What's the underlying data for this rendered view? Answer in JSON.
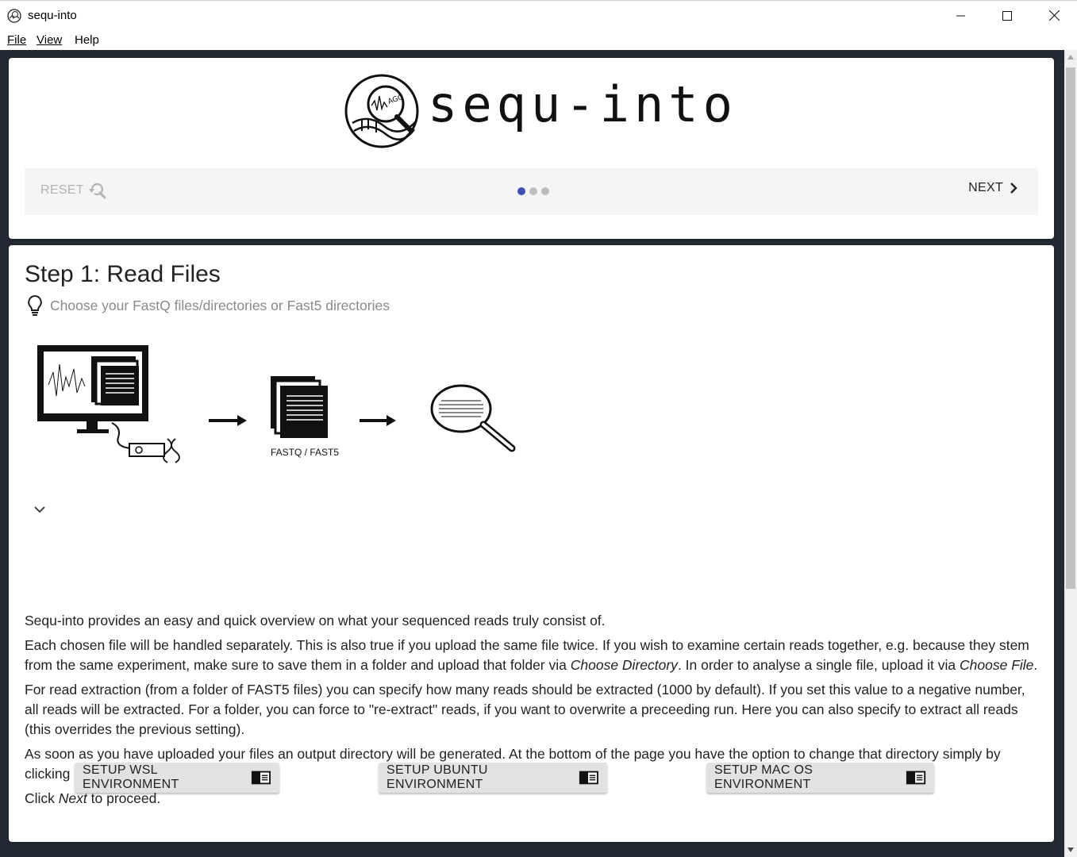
{
  "window": {
    "title": "sequ-into"
  },
  "menu": {
    "file": "File",
    "view": "View",
    "help": "Help"
  },
  "header": {
    "logo_text": "sequ-into",
    "reset_label": "RESET",
    "next_label": "NEXT",
    "steps_total": 3,
    "step_active": 1
  },
  "step": {
    "title": "Step 1: Read Files",
    "hint": "Choose your FastQ files/directories or Fast5 directories",
    "diagram_label": "FASTQ / FAST5"
  },
  "paragraphs": {
    "p1": "Sequ-into provides an easy and quick overview on what your sequenced reads truly consist of.",
    "p2a": "Each chosen file will be handled separately. This is also true if you upload the same file twice. If you wish to examine certain reads together, e.g. because they stem from the same experiment, make sure to save them in a folder and upload that folder via ",
    "p2b": "Choose Directory",
    "p2c": ". In order to analyse a single file, upload it via ",
    "p2d": "Choose File",
    "p2e": ".",
    "p3": "For read extraction (from a folder of FAST5 files) you can specify how many reads should be extracted (1000 by default). If you set this value to a negative number, all reads will be extracted. For a folder, you can force to \"re-extract\" reads, if you want to overwrite a preceeding run. Here you can also specify to extract all reads (this overrides the previous setting).",
    "p4": "As soon as you have uploaded your files an output directory will be generated. At the bottom of the page you have the option to change that directory simply by clicking on the text.",
    "p5a": "Click ",
    "p5b": "Next",
    "p5c": " to proceed."
  },
  "buttons": {
    "wsl": "SETUP WSL ENVIRONMENT",
    "ubuntu": "SETUP UBUNTU ENVIRONMENT",
    "mac": "SETUP MAC OS ENVIRONMENT"
  },
  "colors": {
    "accent": "#3f51b5",
    "background": "#232a33",
    "stepper_bg": "#f5f5f5",
    "button_bg": "#e2e2e2"
  }
}
